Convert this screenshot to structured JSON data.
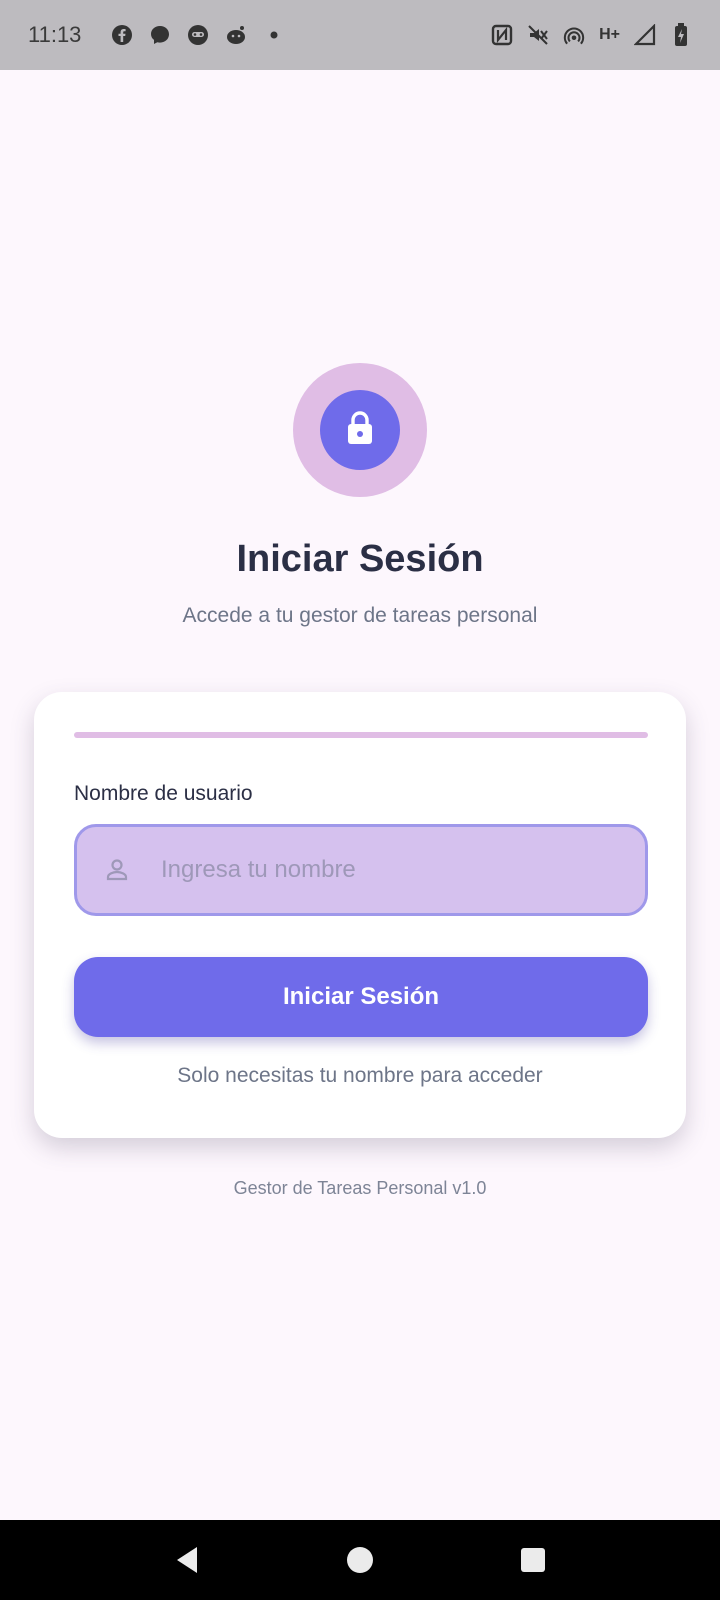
{
  "status_bar": {
    "time": "11:13",
    "left_icons": [
      "facebook-icon",
      "messenger-icon",
      "app-face-icon",
      "reddit-icon",
      "dot-icon"
    ],
    "right_icons": [
      "nfc-icon",
      "vibrate-off-icon",
      "hotspot-icon",
      "signal-icon",
      "battery-icon"
    ],
    "network_type": "H+"
  },
  "header": {
    "logo_icon": "lock-icon",
    "title": "Iniciar Sesión",
    "subtitle": "Accede a tu gestor de tareas personal"
  },
  "form": {
    "username_label": "Nombre de usuario",
    "username_placeholder": "Ingresa tu nombre",
    "username_value": "",
    "username_icon": "person-icon",
    "submit_label": "Iniciar Sesión",
    "hint": "Solo necesitas tu nombre para acceder"
  },
  "footer": {
    "version": "Gestor de Tareas Personal v1.0"
  },
  "nav": {
    "buttons": [
      "back-icon",
      "home-icon",
      "recents-icon"
    ]
  },
  "colors": {
    "accent": "#6f6bea",
    "accent_light": "#e0bde5",
    "input_bg": "#d5c1ee",
    "background": "#fdf7fd"
  }
}
